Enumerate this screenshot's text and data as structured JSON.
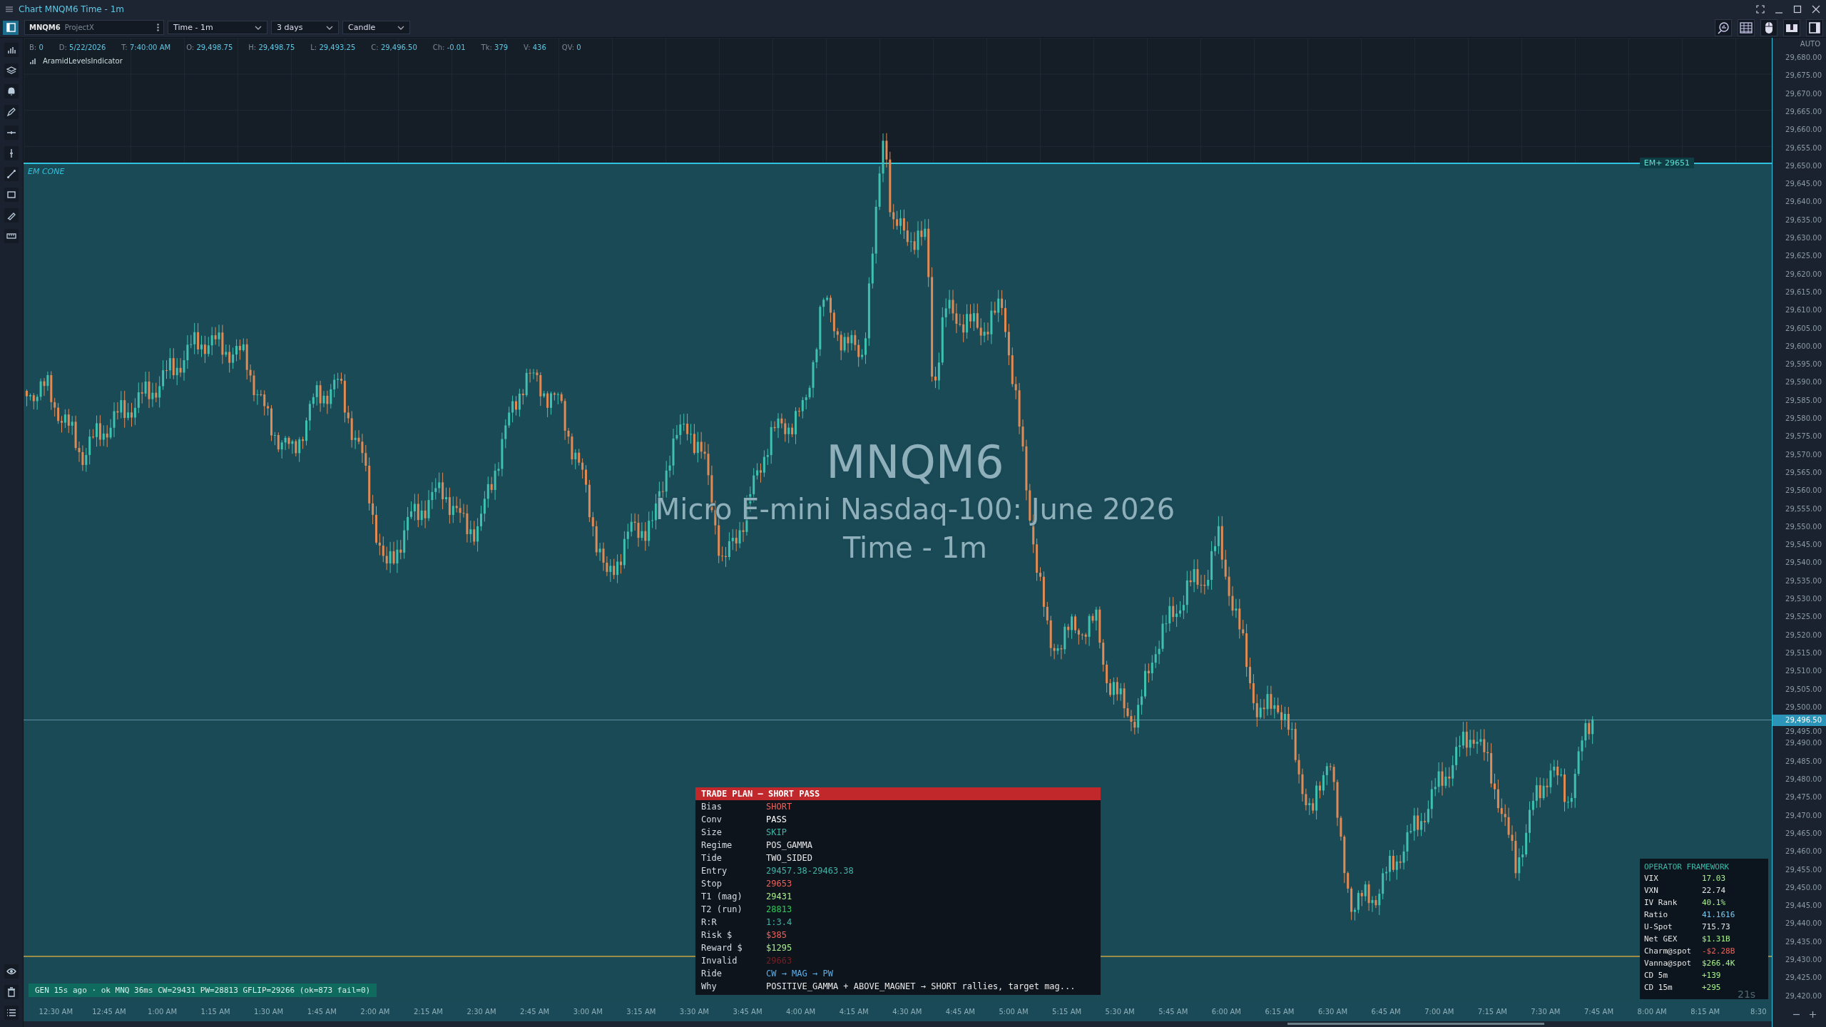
{
  "window": {
    "title": "Chart MNQM6 Time - 1m"
  },
  "toolbar": {
    "symbol": "MNQM6",
    "source": "ProjectX",
    "timeframe": "Time - 1m",
    "range": "3 days",
    "style": "Candle"
  },
  "info": [
    {
      "label": "B:",
      "value": "0"
    },
    {
      "label": "D:",
      "value": "5/22/2026"
    },
    {
      "label": "T:",
      "value": "7:40:00 AM"
    },
    {
      "label": "O:",
      "value": "29,498.75"
    },
    {
      "label": "H:",
      "value": "29,498.75"
    },
    {
      "label": "L:",
      "value": "29,493.25"
    },
    {
      "label": "C:",
      "value": "29,496.50"
    },
    {
      "label": "Ch:",
      "value": "-0.01"
    },
    {
      "label": "Tk:",
      "value": "379"
    },
    {
      "label": "V:",
      "value": "436"
    },
    {
      "label": "QV:",
      "value": "0"
    }
  ],
  "indicator": "AramidLevelsIndicator",
  "watermark": {
    "symbol": "MNQM6",
    "name": "Micro E-mini Nasdaq-100: June 2026",
    "timeframe": "Time - 1m"
  },
  "em_cone": {
    "label": "EM CONE",
    "tag": "EM+ 29651"
  },
  "price_axis": {
    "mode": "AUTO",
    "current": "29,496.50",
    "labels": [
      "29,680.00",
      "29,675.00",
      "29,670.00",
      "29,665.00",
      "29,660.00",
      "29,655.00",
      "29,650.00",
      "29,645.00",
      "29,640.00",
      "29,635.00",
      "29,630.00",
      "29,625.00",
      "29,620.00",
      "29,615.00",
      "29,610.00",
      "29,605.00",
      "29,600.00",
      "29,595.00",
      "29,590.00",
      "29,585.00",
      "29,580.00",
      "29,575.00",
      "29,570.00",
      "29,565.00",
      "29,560.00",
      "29,555.00",
      "29,550.00",
      "29,545.00",
      "29,540.00",
      "29,535.00",
      "29,530.00",
      "29,525.00",
      "29,520.00",
      "29,515.00",
      "29,510.00",
      "29,505.00",
      "29,500.00",
      "29,495.00",
      "29,490.00",
      "29,485.00",
      "29,480.00",
      "29,475.00",
      "29,470.00",
      "29,465.00",
      "29,460.00",
      "29,455.00",
      "29,450.00",
      "29,445.00",
      "29,440.00",
      "29,435.00",
      "29,430.00",
      "29,425.00",
      "29,420.00"
    ]
  },
  "time_axis": [
    "12:30 AM",
    "12:45 AM",
    "1:00 AM",
    "1:15 AM",
    "1:30 AM",
    "1:45 AM",
    "2:00 AM",
    "2:15 AM",
    "2:30 AM",
    "2:45 AM",
    "3:00 AM",
    "3:15 AM",
    "3:30 AM",
    "3:45 AM",
    "4:00 AM",
    "4:15 AM",
    "4:30 AM",
    "4:45 AM",
    "5:00 AM",
    "5:15 AM",
    "5:30 AM",
    "5:45 AM",
    "6:00 AM",
    "6:15 AM",
    "6:30 AM",
    "6:45 AM",
    "7:00 AM",
    "7:15 AM",
    "7:30 AM",
    "7:45 AM",
    "8:00 AM",
    "8:15 AM",
    "8:30"
  ],
  "status": "GEN 15s ago · ok MNQ 36ms CW=29431 PW=28813 GFLIP=29266 (ok=873 fail=0)",
  "timer": "21s",
  "trade_plan": {
    "title": "TRADE PLAN — SHORT PASS",
    "rows": [
      {
        "label": "Bias",
        "value": "SHORT",
        "color": "#f0615a"
      },
      {
        "label": "Conv",
        "value": "PASS",
        "color": "#ffffff"
      },
      {
        "label": "Size",
        "value": "SKIP",
        "color": "#3fb6a8"
      },
      {
        "label": "Regime",
        "value": "POS_GAMMA",
        "color": "#e6e6e6"
      },
      {
        "label": "Tide",
        "value": "TWO_SIDED",
        "color": "#e6e6e6"
      },
      {
        "label": "Entry",
        "value": "29457.38-29463.38",
        "color": "#3fb6a8"
      },
      {
        "label": "Stop",
        "value": "29653",
        "color": "#f0615a"
      },
      {
        "label": "T1 (mag)",
        "value": "29431",
        "color": "#a6f08a"
      },
      {
        "label": "T2 (run)",
        "value": "28813",
        "color": "#2ecc5a"
      },
      {
        "label": "R:R",
        "value": "1:3.4",
        "color": "#3fb6a8"
      },
      {
        "label": "Risk $",
        "value": "$385",
        "color": "#f0615a"
      },
      {
        "label": "Reward $",
        "value": "$1295",
        "color": "#a6f08a"
      },
      {
        "label": "Invalid",
        "value": "29663",
        "color": "#7a1f22"
      },
      {
        "label": "Ride",
        "value": "CW → MAG → PW",
        "color": "#5aaee8"
      },
      {
        "label": "Why",
        "value": "POSITIVE_GAMMA + ABOVE_MAGNET → SHORT rallies, target mag...",
        "color": "#e6e6e6"
      }
    ]
  },
  "operator": {
    "title": "OPERATOR FRAMEWORK",
    "rows": [
      {
        "label": "VIX",
        "value": "17.03",
        "color": "#a6f08a"
      },
      {
        "label": "VXN",
        "value": "22.74",
        "color": "#e6e6e6"
      },
      {
        "label": "IV Rank",
        "value": "40.1%",
        "color": "#a6f08a"
      },
      {
        "label": "Ratio",
        "value": "41.1616",
        "color": "#7cc8f0"
      },
      {
        "label": "U-Spot",
        "value": "715.73",
        "color": "#e6e6e6"
      },
      {
        "label": "Net GEX",
        "value": "$1.31B",
        "color": "#a6f08a"
      },
      {
        "label": "Charm@spot",
        "value": "-$2.28B",
        "color": "#f0615a"
      },
      {
        "label": "Vanna@spot",
        "value": "$266.4K",
        "color": "#a6f08a"
      },
      {
        "label": "CD 5m",
        "value": "+139",
        "color": "#a6f08a"
      },
      {
        "label": "CD 15m",
        "value": "+295",
        "color": "#a6f08a"
      }
    ]
  }
}
